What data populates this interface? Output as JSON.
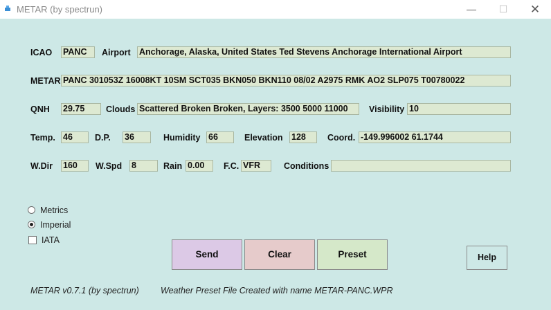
{
  "window": {
    "title": "METAR (by spectrun)",
    "minimize": "—",
    "maximize": "☐",
    "close": "✕"
  },
  "labels": {
    "icao": "ICAO",
    "airport": "Airport",
    "metar": "METAR",
    "qnh": "QNH",
    "clouds": "Clouds",
    "visibility": "Visibility",
    "temp": "Temp.",
    "dp": "D.P.",
    "humidity": "Humidity",
    "elevation": "Elevation",
    "coord": "Coord.",
    "wdir": "W.Dir",
    "wspd": "W.Spd",
    "rain": "Rain",
    "fc": "F.C.",
    "conditions": "Conditions"
  },
  "fields": {
    "icao": "PANC",
    "airport": "Anchorage, Alaska, United States Ted Stevens Anchorage International Airport",
    "metar": "PANC 301053Z 16008KT 10SM SCT035 BKN050 BKN110 08/02 A2975 RMK AO2 SLP075 T00780022",
    "qnh": "29.75",
    "clouds": "Scattered Broken Broken, Layers: 3500 5000 11000",
    "visibility": "10",
    "temp": "46",
    "dp": "36",
    "humidity": "66",
    "elevation": "128",
    "coord": "-149.996002 61.1744",
    "wdir": "160",
    "wspd": "8",
    "rain": "0.00",
    "fc": "VFR",
    "conditions": ""
  },
  "options": {
    "metrics": "Metrics",
    "imperial": "Imperial",
    "iata": "IATA",
    "selected_unit": "Imperial",
    "iata_checked": false
  },
  "buttons": {
    "send": "Send",
    "clear": "Clear",
    "preset": "Preset",
    "help": "Help",
    "send_color": "#dcc9e6",
    "clear_color": "#e6cbcb",
    "preset_color": "#d5e8c9",
    "help_color": "#cde8e6"
  },
  "status": {
    "version": "METAR v0.7.1 (by spectrun)",
    "message": "Weather Preset File Created with name METAR-PANC.WPR"
  },
  "colors": {
    "background": "#cde8e6",
    "field": "#dde9d2"
  }
}
